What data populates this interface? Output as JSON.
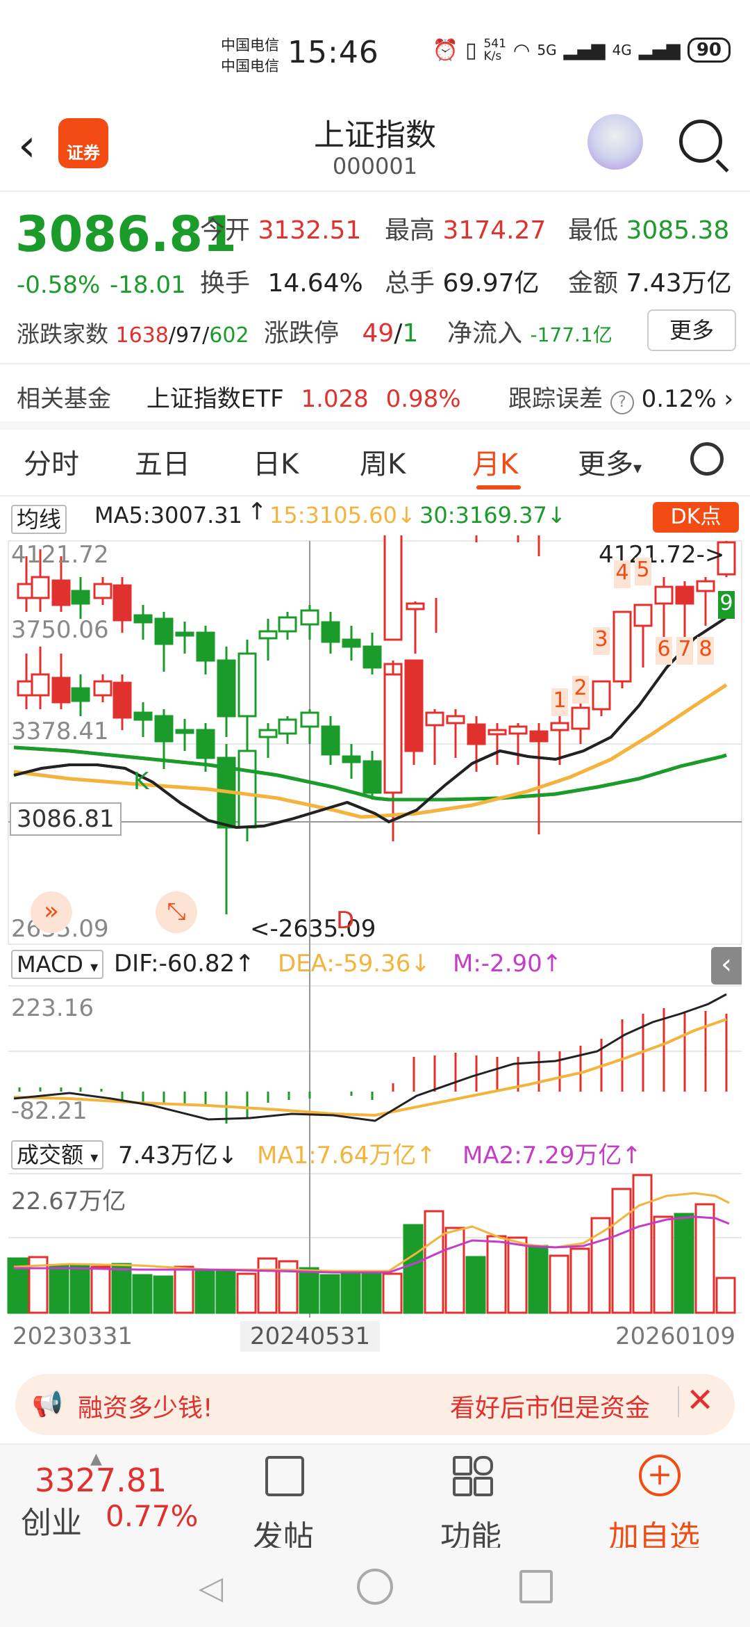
{
  "status": {
    "carrier1": "中国电信",
    "carrier2": "中国电信",
    "time": "15:46",
    "speed": "541\nK/s",
    "net1": "5G",
    "net2": "4G",
    "battery": "90"
  },
  "header": {
    "title": "上证指数",
    "code": "000001",
    "logo_text": "证券"
  },
  "quote": {
    "price": "3086.81",
    "change_pct": "-0.58%",
    "change": "-18.01",
    "open_label": "今开",
    "open": "3132.51",
    "high_label": "最高",
    "high": "3174.27",
    "low_label": "最低",
    "low": "3085.38",
    "turnover_label": "换手",
    "turnover": "14.64%",
    "volume_label": "总手",
    "volume": "69.97亿",
    "amount_label": "金额",
    "amount": "7.43万亿",
    "breadth_label": "涨跌家数",
    "breadth_up": "1638",
    "breadth_flat": "97",
    "breadth_down": "602",
    "limit_label": "涨跌停",
    "limit_up": "49",
    "limit_down": "1",
    "inflow_label": "净流入",
    "inflow": "-177.1亿",
    "more": "更多"
  },
  "fund": {
    "label": "相关基金",
    "name": "上证指数ETF",
    "price": "1.028",
    "pct": "0.98%",
    "err_label": "跟踪误差",
    "err": "0.12%"
  },
  "tabs": [
    "分时",
    "五日",
    "日K",
    "周K",
    "月K",
    "更多"
  ],
  "ma": {
    "type": "均线",
    "ma5": "MA5:3007.31",
    "ma15": "15:3105.60",
    "ma30": "30:3169.37",
    "dk": "DK点"
  },
  "axis": {
    "p1": "4121.72",
    "p2": "3750.06",
    "p3": "3378.41",
    "p4": "2635.09",
    "cur": "3086.81",
    "max_note": "4121.72->",
    "min_note": "<-2635.09",
    "d_note": "D",
    "k_note": "K"
  },
  "signals": [
    "1",
    "2",
    "3",
    "4",
    "5",
    "6",
    "7",
    "8",
    "9"
  ],
  "macd": {
    "label": "MACD",
    "dif": "DIF:-60.82",
    "dea": "DEA:-59.36",
    "m": "M:-2.90",
    "top": "223.16",
    "bottom": "-82.21"
  },
  "vol": {
    "label": "成交额",
    "val": "7.43万亿",
    "ma1": "MA1:7.64万亿",
    "ma2": "MA2:7.29万亿",
    "top": "22.67万亿"
  },
  "dates": {
    "start": "20230331",
    "mid": "20240531",
    "end": "20260109"
  },
  "banner": {
    "left": "融资多少钱!",
    "right": "看好后市但是资金"
  },
  "bottom": {
    "ticker_price": "3327.81",
    "ticker_name": "创业",
    "ticker_pct": "0.77%",
    "post": "发帖",
    "func": "功能",
    "add": "加自选"
  },
  "colors": {
    "accent": "#f24b14",
    "up": "#e0312e",
    "down": "#1a9b2a"
  }
}
